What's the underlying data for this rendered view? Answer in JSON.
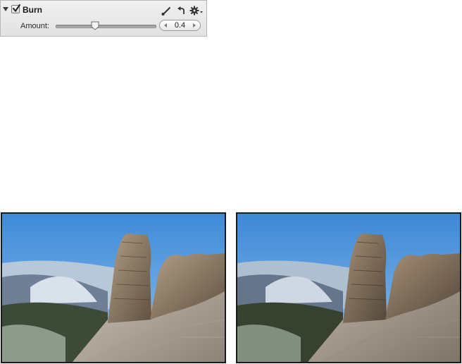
{
  "adjustment": {
    "title": "Burn",
    "enabled": true,
    "expanded": true,
    "icons": [
      "brush-icon",
      "undo-icon",
      "gear-icon"
    ],
    "amount": {
      "label": "Amount:",
      "value": "0.4",
      "level": 0.4
    }
  },
  "photos": {
    "count": 2
  }
}
